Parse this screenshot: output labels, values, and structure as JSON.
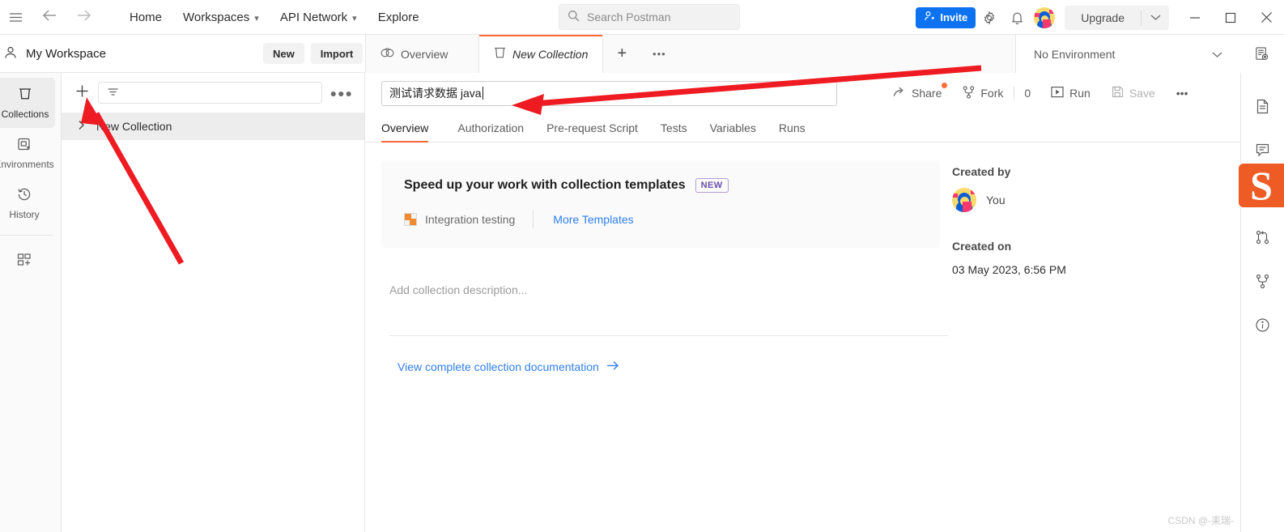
{
  "topbar": {
    "hamburger_icon": "menu-icon",
    "back_icon": "arrow-left-icon",
    "forward_icon": "arrow-right-icon",
    "menu": [
      {
        "label": "Home",
        "caret": false
      },
      {
        "label": "Workspaces",
        "caret": true
      },
      {
        "label": "API Network",
        "caret": true
      },
      {
        "label": "Explore",
        "caret": false
      }
    ],
    "search_placeholder": "Search Postman",
    "invite_label": "Invite",
    "settings_icon": "gear-icon",
    "notifications_icon": "bell-icon",
    "avatar_icon": "user-avatar",
    "upgrade_label": "Upgrade",
    "upgrade_caret": "chevron-down-icon",
    "minimize_label": "—",
    "maximize_label": "□",
    "close_label": "✕"
  },
  "workspace": {
    "name": "My Workspace",
    "new_label": "New",
    "import_label": "Import"
  },
  "tabs": [
    {
      "label": "Overview",
      "icon": "overview-icon",
      "active": false
    },
    {
      "label": "New Collection",
      "icon": "collection-icon",
      "active": true
    }
  ],
  "tab_actions": {
    "new_tab_label": "+",
    "more_label": "•••"
  },
  "environment": {
    "selected": "No Environment",
    "caret": "chevron-down-icon",
    "eye_icon": "environment-quick-look-icon"
  },
  "rail": {
    "items": [
      {
        "label": "Collections",
        "icon": "collections-icon",
        "active": true
      },
      {
        "label": "Environments",
        "icon": "environments-icon",
        "active": false
      },
      {
        "label": "History",
        "icon": "history-icon",
        "active": false
      }
    ],
    "new_label": "",
    "new_icon": "new-panel-icon"
  },
  "sidebar": {
    "add_icon": "plus-icon",
    "filter_icon": "filter-icon",
    "filter_value": "",
    "more_icon": "more-options-icon",
    "collections": [
      {
        "name": "New Collection",
        "expanded": false,
        "chevron": "chevron-right-icon"
      }
    ]
  },
  "collection": {
    "name_value": "测试请求数据 java",
    "actions": {
      "share_label": "Share",
      "share_icon": "share-icon",
      "share_has_badge": true,
      "fork_label": "Fork",
      "fork_icon": "fork-icon",
      "fork_count": "0",
      "run_label": "Run",
      "run_icon": "play-icon",
      "save_label": "Save",
      "save_icon": "save-icon",
      "save_disabled": true,
      "more_label": "•••"
    },
    "subtabs": [
      {
        "label": "Overview",
        "active": true
      },
      {
        "label": "Authorization",
        "active": false
      },
      {
        "label": "Pre-request Script",
        "active": false
      },
      {
        "label": "Tests",
        "active": false
      },
      {
        "label": "Variables",
        "active": false
      },
      {
        "label": "Runs",
        "active": false
      }
    ]
  },
  "promo": {
    "title": "Speed up your work with collection templates",
    "badge": "NEW",
    "template_label": "Integration testing",
    "template_icon": "puzzle-icon",
    "more_templates_label": "More Templates"
  },
  "description": {
    "placeholder": "Add collection description...",
    "doc_link": "View complete collection documentation",
    "doc_link_icon": "arrow-right-icon"
  },
  "meta": {
    "created_by_label": "Created by",
    "created_by_value": "You",
    "created_on_label": "Created on",
    "created_on_value": "03 May 2023, 6:56 PM"
  },
  "right_rail": {
    "items": [
      {
        "icon": "documentation-icon"
      },
      {
        "icon": "comments-icon"
      },
      {
        "icon": "changelog-icon"
      },
      {
        "icon": "pull-requests-icon"
      },
      {
        "icon": "forks-icon"
      },
      {
        "icon": "info-icon"
      }
    ],
    "overlay_logo": "S"
  },
  "watermark": "CSDN @-耒瑞-",
  "annotations": {
    "arrow_color": "#ee1c22",
    "arrow1_desc": "arrow pointing to collection name input",
    "arrow2_desc": "arrow pointing to sidebar add button"
  },
  "colors": {
    "accent_orange": "#ff6c37",
    "primary_blue": "#0c72f0",
    "link_blue": "#2f7ff0",
    "badge_purple": "#6a4fab"
  }
}
